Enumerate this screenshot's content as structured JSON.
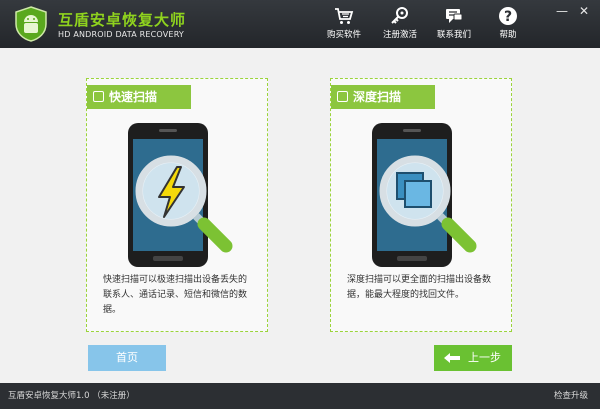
{
  "app": {
    "title": "互盾安卓恢复大师",
    "subtitle": "HD ANDROID DATA RECOVERY"
  },
  "nav": [
    {
      "label": "购买软件",
      "icon": "cart-icon"
    },
    {
      "label": "注册激活",
      "icon": "key-icon"
    },
    {
      "label": "联系我们",
      "icon": "chat-icon"
    },
    {
      "label": "帮助",
      "icon": "help-icon"
    }
  ],
  "window_controls": {
    "minimize": "—",
    "close": "✕"
  },
  "cards": [
    {
      "label": "快速扫描",
      "desc": "快速扫描可以极速扫描出设备丢失的联系人、通话记录、短信和微信的数据。",
      "illustration": "lightning-icon"
    },
    {
      "label": "深度扫描",
      "desc": "深度扫描可以更全面的扫描出设备数据，能最大程度的找回文件。",
      "illustration": "layers-icon"
    }
  ],
  "buttons": {
    "home": "首页",
    "prev": "上一步"
  },
  "footer": {
    "version": "互盾安卓恢复大师1.0 （未注册）",
    "update": "检查升级"
  },
  "colors": {
    "accent": "#8cc63f",
    "header": "#2c2f33",
    "home_btn": "#87c5ea",
    "prev_btn": "#6ac132"
  }
}
